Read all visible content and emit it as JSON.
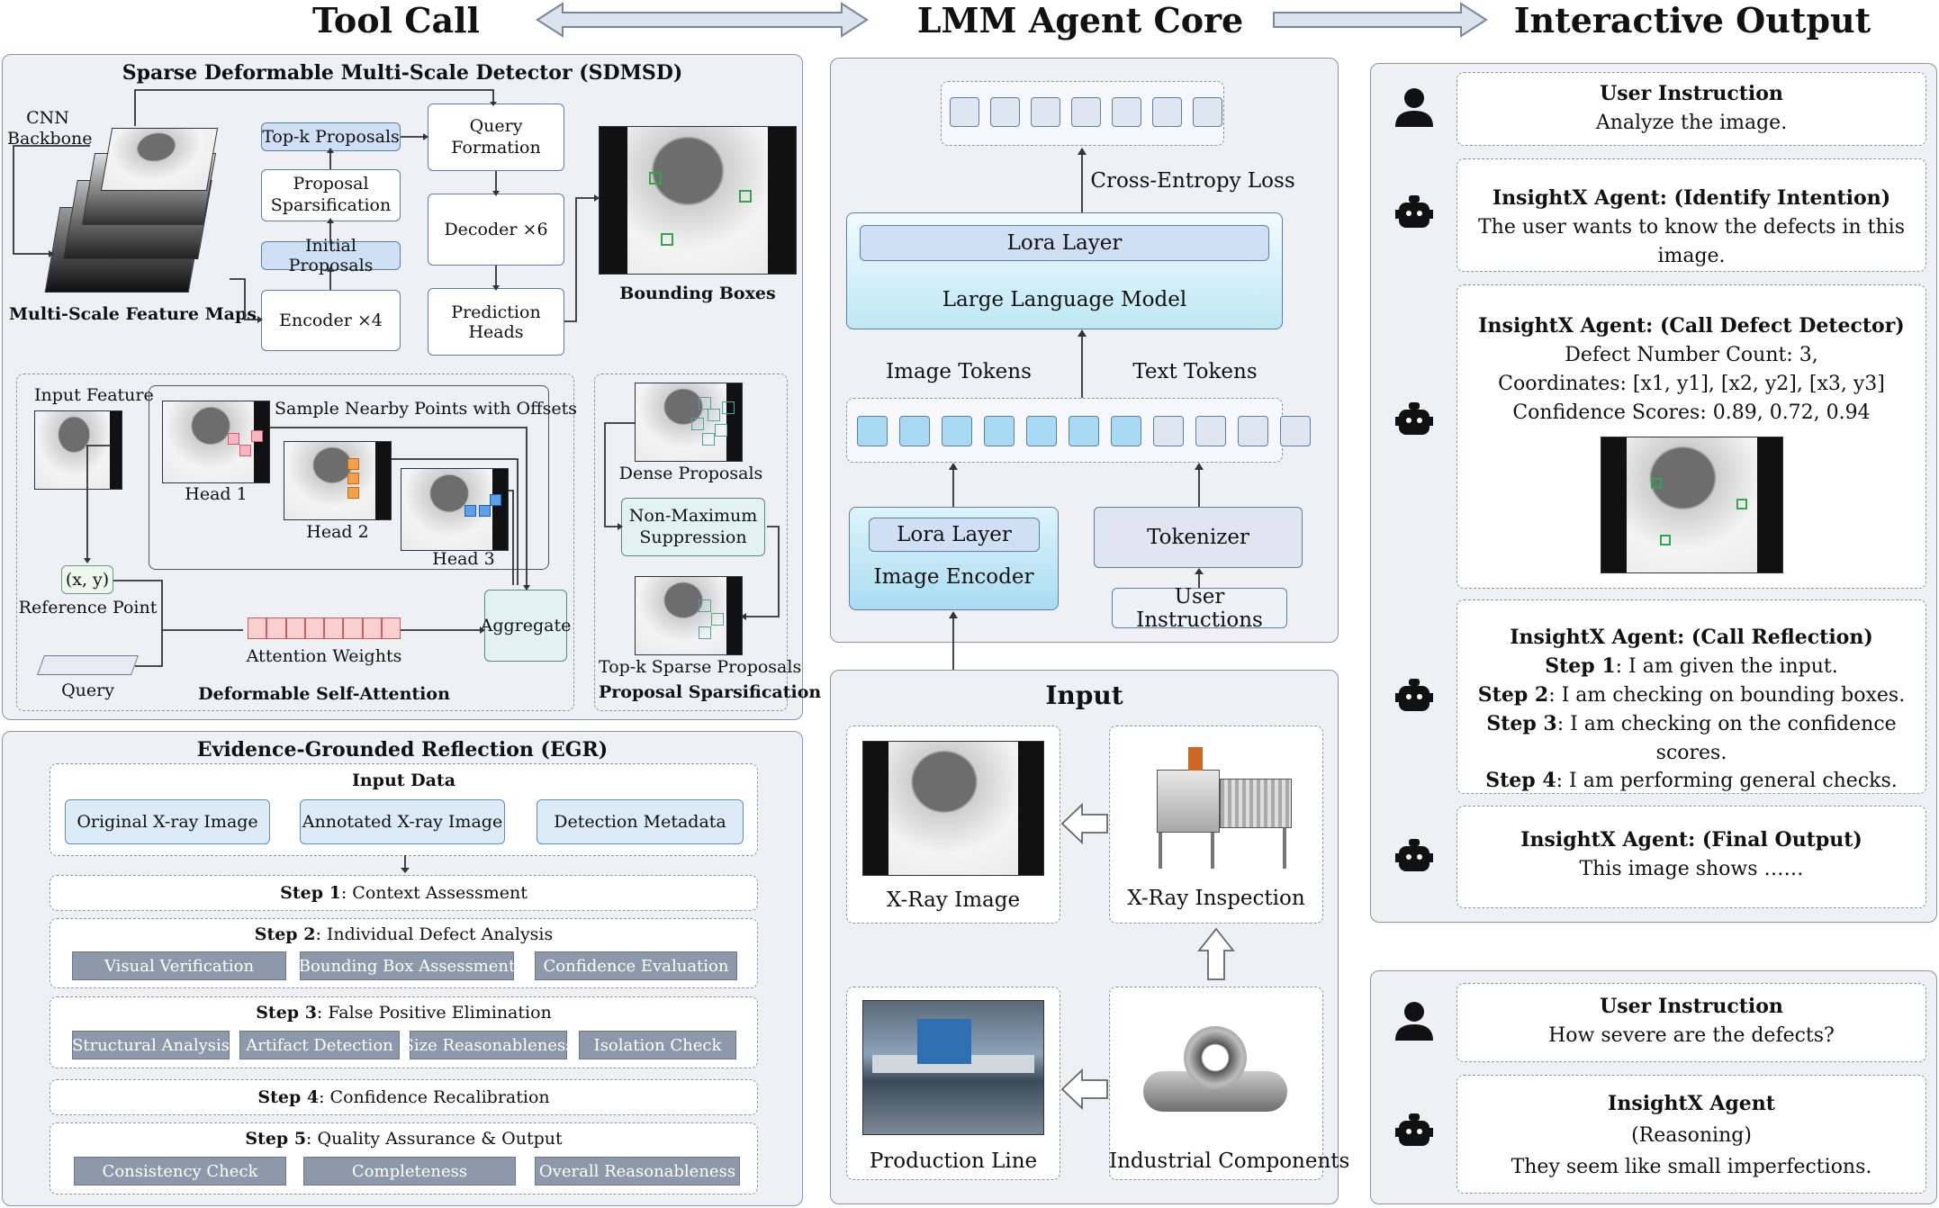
{
  "headers": {
    "tool_call": "Tool Call",
    "agent_core": "LMM Agent Core",
    "output": "Interactive Output"
  },
  "sdmsd": {
    "title": "Sparse Deformable Multi-Scale Detector (SDMSD)",
    "cnn": "CNN Backbone",
    "feature_maps": "Multi-Scale Feature Maps",
    "topk": "Top-k Proposals",
    "proposal_sparsification": "Proposal Sparsification",
    "initial_proposals": "Initial Proposals",
    "encoder": "Encoder ×4",
    "query_formation": "Query Formation",
    "decoder": "Decoder ×6",
    "prediction_heads": "Prediction Heads",
    "bounding_boxes": "Bounding Boxes",
    "input_feature": "Input Feature",
    "sample_points": "Sample Nearby Points with Offsets",
    "head1": "Head 1",
    "head2": "Head 2",
    "head3": "Head 3",
    "ref_coord": "(x, y)",
    "reference_point": "Reference Point",
    "attention_weights": "Attention Weights",
    "aggregate": "Aggregate",
    "query": "Query",
    "deformable_attention": "Deformable Self-Attention",
    "dense_proposals": "Dense Proposals",
    "nms": "Non-Maximum Suppression",
    "topk_sparse": "Top-k Sparse Proposals",
    "proposal_sparsification_title": "Proposal Sparsification"
  },
  "egr": {
    "title": "Evidence-Grounded Reflection (EGR)",
    "input_data": "Input Data",
    "inputs": [
      "Original X-ray Image",
      "Annotated X-ray Image",
      "Detection Metadata"
    ],
    "steps": [
      {
        "label": "Step 1",
        "text": ": Context Assessment",
        "items": []
      },
      {
        "label": "Step 2",
        "text": ": Individual Defect Analysis",
        "items": [
          "Visual Verification",
          "Bounding Box Assessment",
          "Confidence Evaluation"
        ]
      },
      {
        "label": "Step 3",
        "text": ": False Positive Elimination",
        "items": [
          "Structural Analysis",
          "Artifact Detection",
          "Size Reasonableness",
          "Isolation Check"
        ]
      },
      {
        "label": "Step 4",
        "text": ": Confidence Recalibration",
        "items": []
      },
      {
        "label": "Step 5",
        "text": ": Quality Assurance & Output",
        "items": [
          "Consistency Check",
          "Completeness",
          "Overall Reasonableness"
        ]
      }
    ]
  },
  "core": {
    "cross_entropy": "Cross-Entropy Loss",
    "lora_layer": "Lora Layer",
    "llm": "Large Language Model",
    "image_tokens": "Image Tokens",
    "text_tokens": "Text Tokens",
    "lora_layer2": "Lora Layer",
    "image_encoder": "Image Encoder",
    "tokenizer": "Tokenizer",
    "user_instructions": "User Instructions"
  },
  "input_panel": {
    "title": "Input",
    "xray_image": "X-Ray Image",
    "xray_inspection": "X-Ray Inspection",
    "production_line": "Production Line",
    "industrial_components": "Industrial Components"
  },
  "chat1": {
    "user_title": "User Instruction",
    "user_text": "Analyze the image.",
    "intent_title": "InsightX Agent: (Identify Intention)",
    "intent_text": "The user wants to know the defects in this image.",
    "detector_title": "InsightX Agent: (Call Defect Detector)",
    "detector_count": "Defect Number Count: 3,",
    "detector_coords": "Coordinates: [x1, y1], [x2, y2], [x3, y3]",
    "detector_conf": "Confidence Scores: 0.89, 0.72, 0.94",
    "reflection_title": "InsightX Agent: (Call Reflection)",
    "reflection_steps": [
      {
        "label": "Step 1",
        "text": ": I am given the input."
      },
      {
        "label": "Step 2",
        "text": ": I am checking on bounding boxes."
      },
      {
        "label": "Step 3",
        "text": ": I am checking on the confidence scores."
      },
      {
        "label": "Step 4",
        "text": ": I am performing general checks."
      }
    ],
    "final_title": "InsightX Agent: (Final Output)",
    "final_text": "This image shows ……"
  },
  "chat2": {
    "user_title": "User Instruction",
    "user_text": "How severe are the defects?",
    "agent_title": "InsightX Agent",
    "agent_sub": "(Reasoning)",
    "agent_text": "They seem like small imperfections."
  },
  "icons": [
    "person-icon",
    "robot-icon",
    "double-arrow-icon",
    "right-arrow-icon"
  ]
}
